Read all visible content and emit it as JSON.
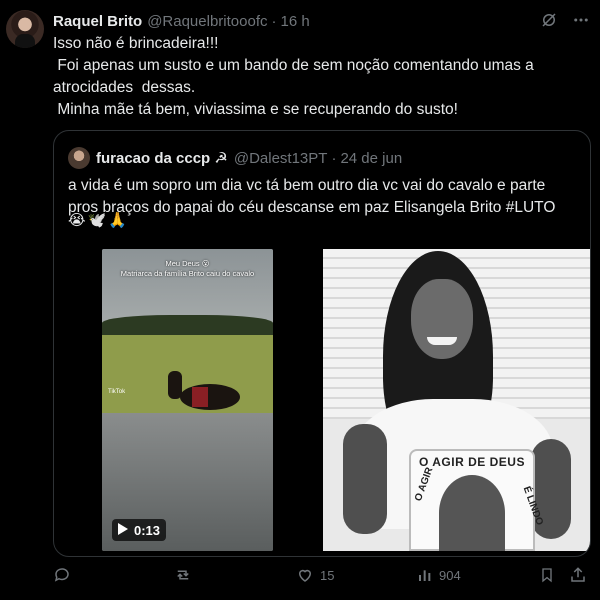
{
  "tweet": {
    "author_name": "Raquel Brito",
    "author_handle": "@Raquelbritooofc",
    "separator": "·",
    "time": "16 h",
    "text": "Isso não é brincadeira!!!\n Foi apenas um susto e um bando de sem noção comentando umas a atrocidades  dessas.\n Minha mãe tá bem, viviassima e se recuperando do susto!"
  },
  "quote": {
    "author_name": "furacao da cccp ☭",
    "author_handle": "@Dalest13PT",
    "separator": "·",
    "time": "24 de jun",
    "text": "a vida é um sopro um dia vc tá bem outro dia vc vai do cavalo e parte pros braços do papai do céu descanse em paz Elisangela Brito #LUTO",
    "emoji": "😭🕊️🙏",
    "video": {
      "caption_line1": "Meu Deus 😮",
      "caption_line2": "Matriarca da família Brito caiu do cavalo",
      "watermark": "TikTok",
      "duration": "0:13"
    },
    "photo": {
      "shirt_text_top": "O AGIR DE DEUS",
      "shirt_text_left": "O AGIR",
      "shirt_text_right": "É LINDO"
    }
  },
  "actions": {
    "likes": "15",
    "views": "904"
  },
  "colors": {
    "background": "#000000",
    "text": "#e7e9ea",
    "muted": "#71767b",
    "border": "#2f3336"
  },
  "icons": {
    "grok": "grok-icon",
    "more": "more-icon",
    "reply": "reply-icon",
    "retweet": "retweet-icon",
    "like": "like-icon",
    "views": "views-icon",
    "bookmark": "bookmark-icon",
    "share": "share-icon",
    "play": "play-icon"
  }
}
